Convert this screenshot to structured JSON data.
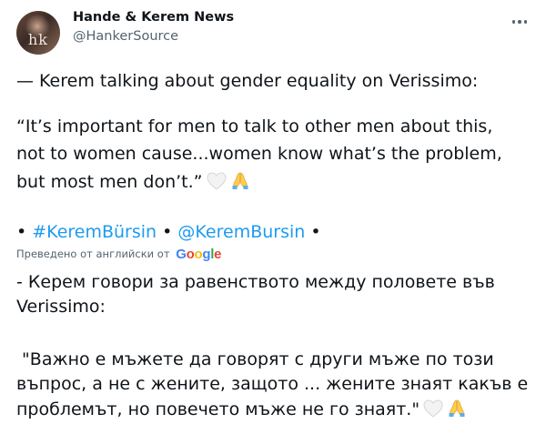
{
  "account": {
    "display_name": "Hande & Kerem News",
    "handle": "@HankerSource",
    "avatar_text": "hk"
  },
  "tweet": {
    "line1": "— Kerem talking about gender equality on Verissimo:",
    "quote": [
      "“It’s important for men to talk to other men about this,",
      "not to women cause...women know what’s the problem,",
      "but most men don’t.”"
    ],
    "hashtags": {
      "bullet": "•",
      "hashtag": "#KeremBürsin",
      "mention": "@KeremBursin"
    }
  },
  "translation": {
    "label": "Преведено от английски от",
    "provider": "Google",
    "lines": [
      "- Керем говори за равенството между половете във",
      "Verissimo:",
      " \"Важно е мъжете да говорят с други мъже по този",
      "въпрос, а не с жените, защото ... жените знаят какъв е",
      "проблемът, но повечето мъже не го знаят.\""
    ]
  },
  "icons": {
    "more": "more-horizontal-icon",
    "heart": "white-heart-emoji",
    "pray": "folded-hands-emoji"
  },
  "colors": {
    "text": "#0f1419",
    "secondary": "#536471",
    "link": "#1d9bf0",
    "google": [
      "#4285F4",
      "#EA4335",
      "#FBBC05",
      "#4285F4",
      "#34A853",
      "#EA4335"
    ]
  }
}
